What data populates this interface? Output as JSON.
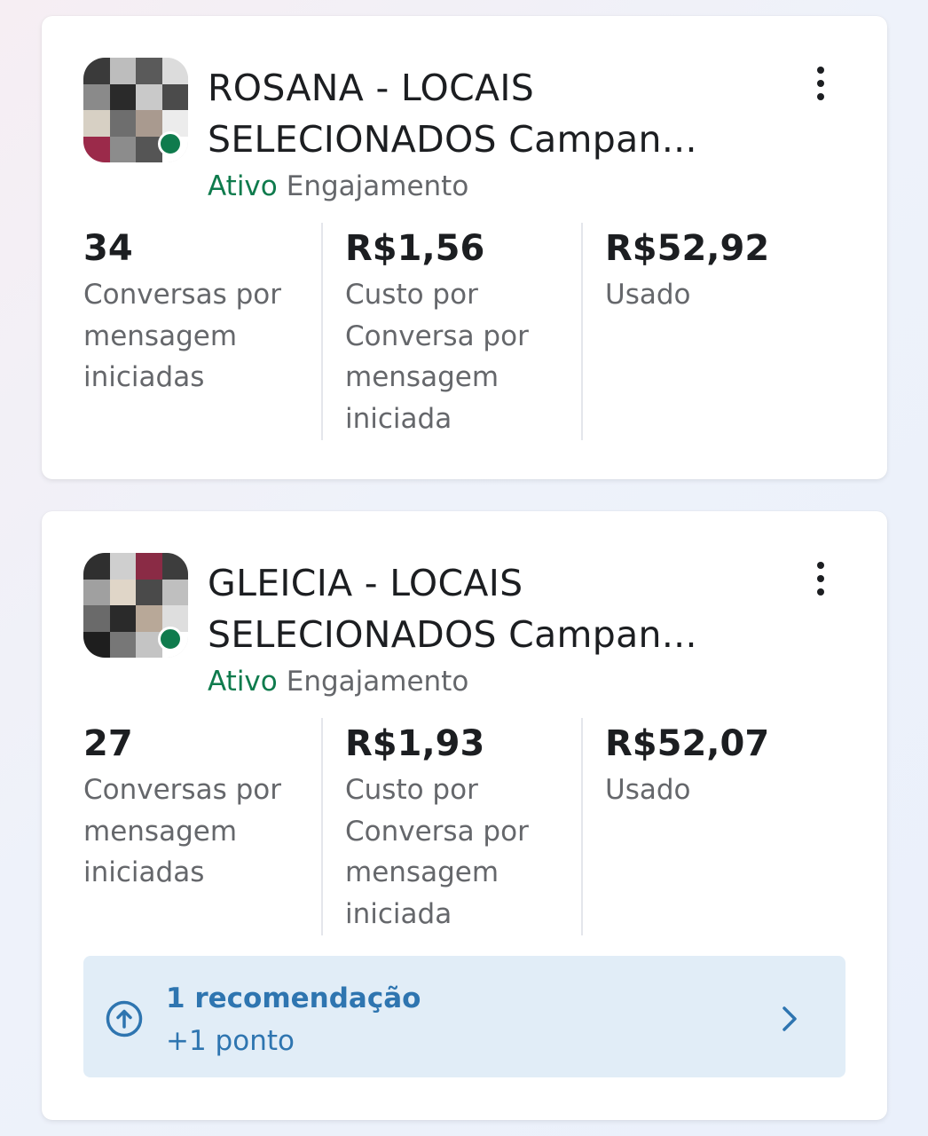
{
  "colors": {
    "active_green": "#0f7b4d",
    "recommendation_blue": "#2e75b0",
    "recommendation_bg": "#e1edf7",
    "muted_text": "#65676b"
  },
  "campaigns": [
    {
      "title_line1": "ROSANA - LOCAIS",
      "title_line2": "SELECIONADOS Campan...",
      "status": "Ativo",
      "objective": "Engajamento",
      "metrics": [
        {
          "value": "34",
          "label": "Conversas por\nmensagem\niniciadas"
        },
        {
          "value": "R$1,56",
          "label": "Custo por\nConversa por\nmensagem\niniciada"
        },
        {
          "value": "R$52,92",
          "label": "Usado"
        }
      ]
    },
    {
      "title_line1": "GLEICIA - LOCAIS",
      "title_line2": "SELECIONADOS Campan...",
      "status": "Ativo",
      "objective": "Engajamento",
      "metrics": [
        {
          "value": "27",
          "label": "Conversas por\nmensagem\niniciadas"
        },
        {
          "value": "R$1,93",
          "label": "Custo por\nConversa por\nmensagem\niniciada"
        },
        {
          "value": "R$52,07",
          "label": "Usado"
        }
      ],
      "recommendation": {
        "title": "1 recomendação",
        "subtitle": "+1 ponto"
      }
    }
  ],
  "icons": {
    "menu": "more-vertical-icon",
    "recommendation": "arrow-up-circle-icon",
    "chevron": "chevron-right-icon"
  }
}
